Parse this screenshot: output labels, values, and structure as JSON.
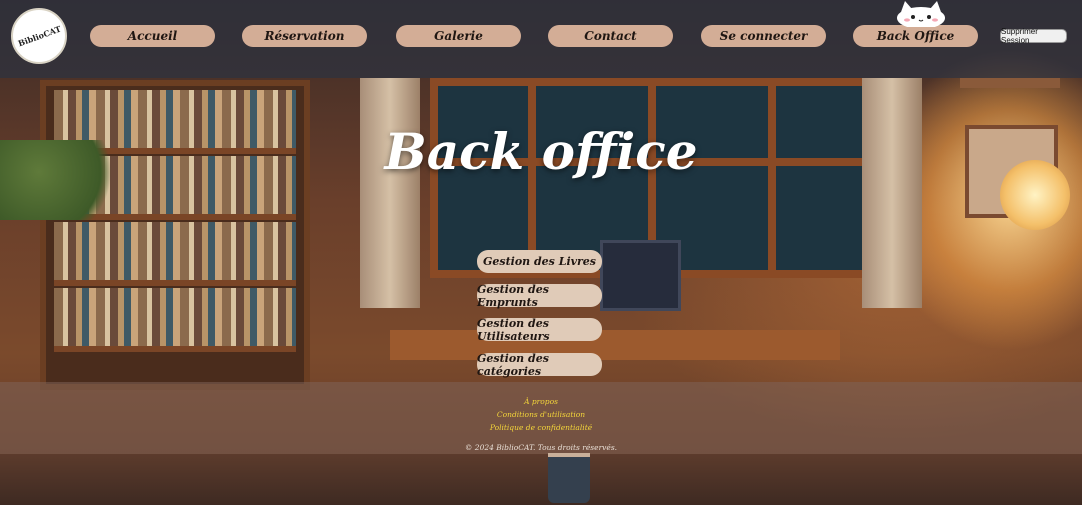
{
  "logo": {
    "text": "BiblioCAT"
  },
  "nav": {
    "items": [
      {
        "label": "Accueil"
      },
      {
        "label": "Réservation"
      },
      {
        "label": "Galerie"
      },
      {
        "label": "Contact"
      },
      {
        "label": "Se connecter"
      },
      {
        "label": "Back Office"
      }
    ],
    "session_button": "Supprimer Session"
  },
  "main": {
    "title": "Back office",
    "actions": [
      {
        "label": "Gestion des Livres"
      },
      {
        "label": "Gestion des Emprunts"
      },
      {
        "label": "Gestion des Utilisateurs"
      },
      {
        "label": "Gestion des catégories"
      }
    ]
  },
  "footer": {
    "links": [
      {
        "label": "À propos"
      },
      {
        "label": "Conditions d'utilisation"
      },
      {
        "label": "Politique de confidentialité"
      }
    ],
    "copyright": "© 2024 BiblioCAT. Tous droits réservés."
  },
  "colors": {
    "nav_button": "#d3ad96",
    "action_button": "#e0cbb8",
    "footer_link": "#f3d53a"
  },
  "icons": [
    "cat-mascot-icon",
    "logo-icon"
  ]
}
